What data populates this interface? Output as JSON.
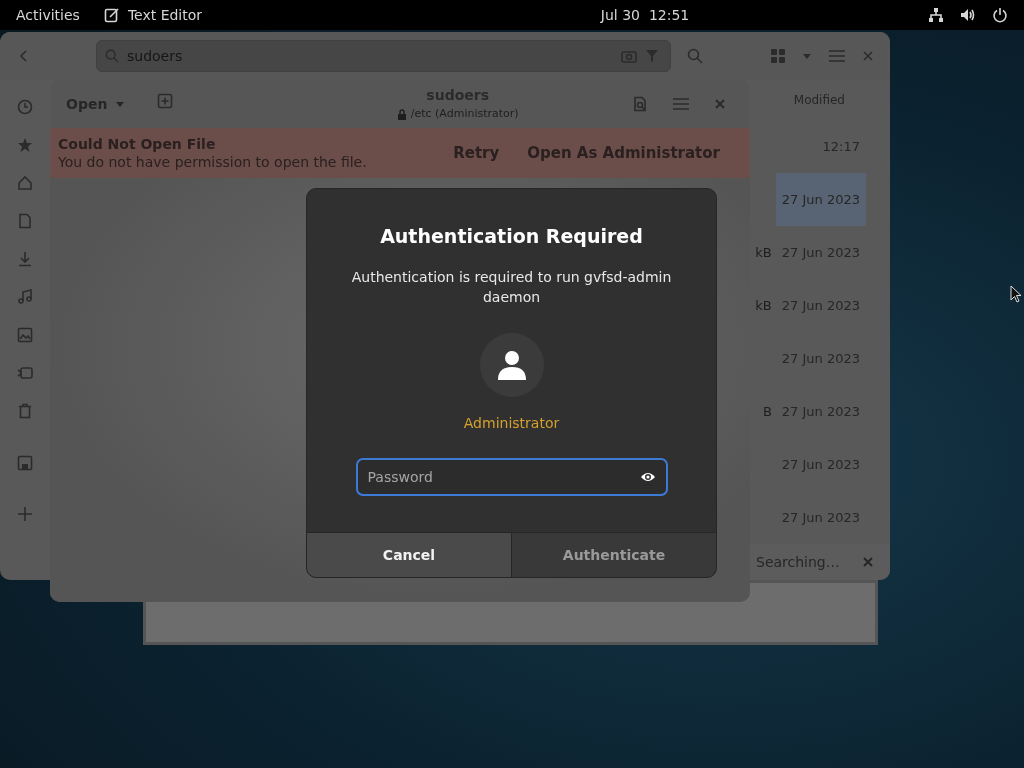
{
  "top_bar": {
    "activities": "Activities",
    "app": "Text Editor",
    "clock": "Jul 30  12:51"
  },
  "files_window": {
    "search": {
      "value": "sudoers"
    },
    "column_header": "Modified",
    "rows": [
      {
        "modified": "12:17",
        "selected": false
      },
      {
        "modified": "27 Jun 2023",
        "selected": true
      },
      {
        "size": "kB",
        "modified": "27 Jun 2023",
        "selected": false
      },
      {
        "size": "kB",
        "modified": "27 Jun 2023",
        "selected": false
      },
      {
        "modified": "27 Jun 2023",
        "selected": false
      },
      {
        "size": "B",
        "modified": "27 Jun 2023",
        "selected": false
      },
      {
        "modified": "27 Jun 2023",
        "selected": false
      },
      {
        "modified": "27 Jun 2023",
        "selected": false
      }
    ],
    "status": "Searching…"
  },
  "editor_window": {
    "open_button": "Open",
    "title": "sudoers",
    "subtitle": "/etc (Administrator)",
    "infobar": {
      "title": "Could Not Open File",
      "message": "You do not have permission to open the file.",
      "buttons": [
        "Retry",
        "Open As Administrator"
      ]
    }
  },
  "dialog": {
    "title": "Authentication Required",
    "message": "Authentication is required to run gvfsd-admin daemon",
    "user": "Administrator",
    "password": {
      "placeholder": "Password"
    },
    "buttons": [
      {
        "label": "Cancel",
        "disabled": false
      },
      {
        "label": "Authenticate",
        "disabled": true
      }
    ]
  }
}
